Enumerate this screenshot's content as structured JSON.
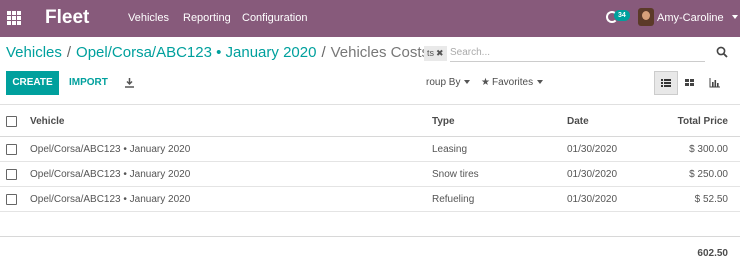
{
  "navbar": {
    "brand": "Fleet",
    "menu": [
      "Vehicles",
      "Reporting",
      "Configuration"
    ],
    "chat_badge": "34",
    "user_name": "Amy-Caroline",
    "user_cut": "Ve"
  },
  "breadcrumb": {
    "items": [
      "Vehicles",
      "Opel/Corsa/ABC123 • January 2020"
    ],
    "current": "Vehicles Costs",
    "separator": "/"
  },
  "search": {
    "facet_label": "ts",
    "placeholder": "Search..."
  },
  "controls": {
    "create_label": "CREATE",
    "import_label": "IMPORT",
    "groupby_label": "roup By",
    "favorites_label": "Favorites"
  },
  "table": {
    "columns": [
      "Vehicle",
      "Type",
      "Date",
      "Total Price"
    ],
    "rows": [
      {
        "vehicle": "Opel/Corsa/ABC123 • January 2020",
        "type": "Leasing",
        "date": "01/30/2020",
        "price": "$ 300.00"
      },
      {
        "vehicle": "Opel/Corsa/ABC123 • January 2020",
        "type": "Snow tires",
        "date": "01/30/2020",
        "price": "$ 250.00"
      },
      {
        "vehicle": "Opel/Corsa/ABC123 • January 2020",
        "type": "Refueling",
        "date": "01/30/2020",
        "price": "$ 52.50"
      }
    ],
    "total": "602.50"
  },
  "colors": {
    "navbar": "#875a7b",
    "accent": "#00a09d"
  }
}
